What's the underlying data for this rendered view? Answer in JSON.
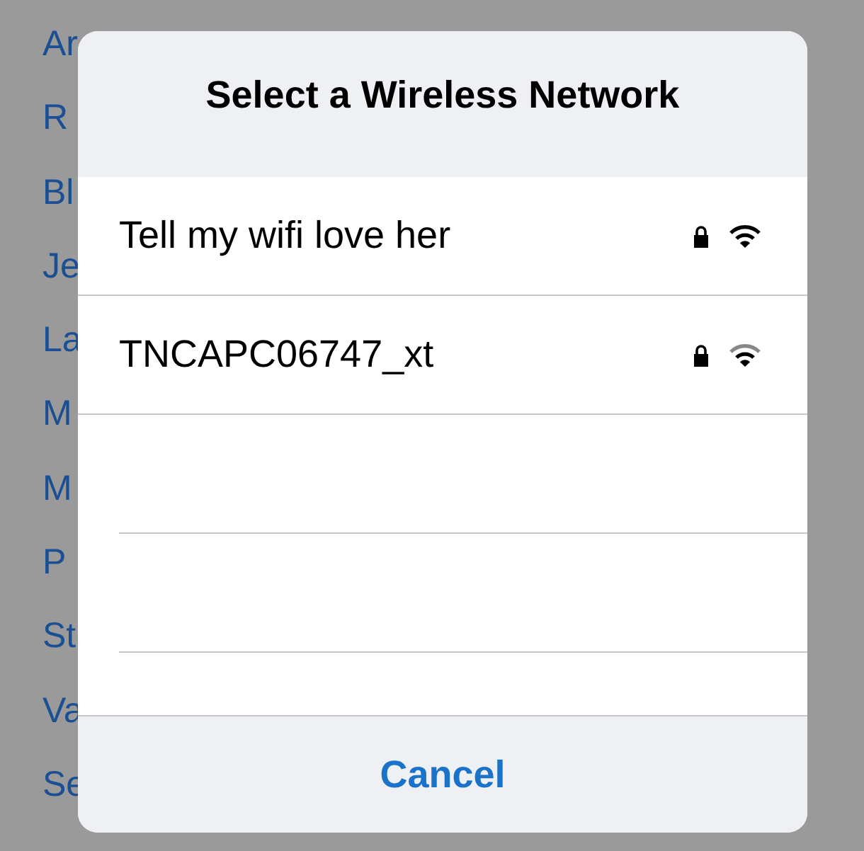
{
  "background_list": [
    "Ar",
    "R",
    "Bl",
    "Je",
    "La",
    "M",
    "M",
    "P",
    "St",
    "Va",
    "Se"
  ],
  "dialog": {
    "title": "Select a Wireless Network",
    "networks": [
      {
        "name": "Tell my wifi love her",
        "locked": true,
        "kind": "strong"
      },
      {
        "name": "TNCAPC06747_xt",
        "locked": true,
        "kind": "medium"
      }
    ],
    "cancel": "Cancel"
  }
}
